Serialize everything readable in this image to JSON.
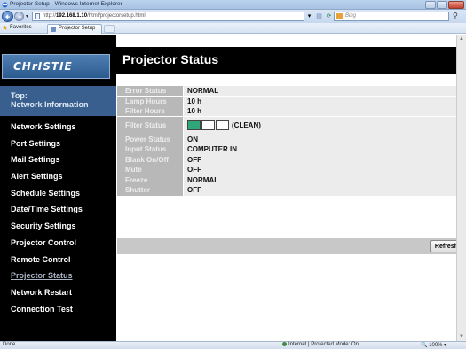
{
  "window": {
    "title": "Projector Setup - Windows Internet Explorer"
  },
  "browser": {
    "url_prefix": "http://",
    "url_host": "192.168.1.10",
    "url_path": "/html/projectorsetup.html",
    "search_placeholder": "Bing",
    "favorites_label": "Favorites",
    "tab_label": "Projector Setup"
  },
  "sidebar": {
    "logo_text": "CHrISTIE",
    "top_label": "Top:\nNetwork Information",
    "items": [
      {
        "label": "Network Settings"
      },
      {
        "label": "Port Settings"
      },
      {
        "label": "Mail Settings"
      },
      {
        "label": "Alert Settings"
      },
      {
        "label": "Schedule Settings"
      },
      {
        "label": "Date/Time Settings"
      },
      {
        "label": "Security Settings"
      },
      {
        "label": "Projector Control"
      },
      {
        "label": "Remote Control"
      },
      {
        "label": "Projector Status"
      },
      {
        "label": "Network Restart"
      },
      {
        "label": "Connection Test"
      }
    ]
  },
  "main": {
    "title": "Projector Status",
    "rows": [
      {
        "key": "Error Status",
        "value": "NORMAL"
      },
      {
        "key": "Lamp Hours",
        "value": "10 h"
      },
      {
        "key": "Filter Hours",
        "value": "10 h"
      },
      {
        "key": "Filter Status",
        "value": "(CLEAN)"
      },
      {
        "key": "Power Status",
        "value": "ON"
      },
      {
        "key": "Input Status",
        "value": "COMPUTER IN"
      },
      {
        "key": "Blank On/Off",
        "value": "OFF"
      },
      {
        "key": "Mute",
        "value": "OFF"
      },
      {
        "key": "Freeze",
        "value": "NORMAL"
      },
      {
        "key": "Shutter",
        "value": "OFF"
      }
    ],
    "filter_level": {
      "filled": 1,
      "total": 3
    },
    "refresh_label": "Refresh"
  },
  "statusbar": {
    "left": "Done",
    "zone": "Internet | Protected Mode: On",
    "zoom": "100%"
  },
  "colors": {
    "sidebar_bg": "#000000",
    "nav_top_bg": "#385f8e",
    "key_cell": "#b8b8b8",
    "value_cell": "#ececec",
    "filter_on": "#2fa77a"
  }
}
